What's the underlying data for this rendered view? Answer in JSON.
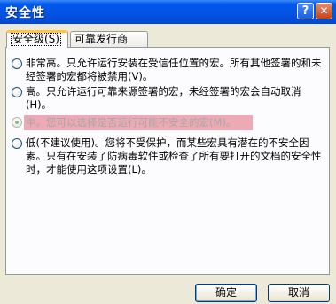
{
  "window": {
    "title": "安全性",
    "help_button": "?",
    "close_button": "✕"
  },
  "tabs": [
    {
      "label": "安全级(S)",
      "active": true
    },
    {
      "label": "可靠发行商",
      "active": false
    }
  ],
  "options": [
    {
      "text": "非常高。只允许运行安装在受信任位置的宏。所有其他签署的和未经签署的宏都将被禁用(V)。",
      "selected": false,
      "disabled": false
    },
    {
      "text": "高。只允许运行可靠来源签署的宏，未经签署的宏会自动取消(H)。",
      "selected": false,
      "disabled": false
    },
    {
      "text": "中。您可以选择是否运行可能不安全的宏(M)。",
      "selected": true,
      "disabled": true
    },
    {
      "text": "低(不建议使用)。您将不受保护，而某些宏具有潜在的不安全因素。只有在安装了防病毒软件或检查了所有要打开的文档的安全性时，才能使用这项设置(L)。",
      "selected": false,
      "disabled": false
    }
  ],
  "buttons": {
    "ok": "确定",
    "cancel": "取消"
  },
  "colors": {
    "titlebar": "#0553e3",
    "highlight": "#dd465a",
    "dialog_bg": "#ece9d8"
  }
}
